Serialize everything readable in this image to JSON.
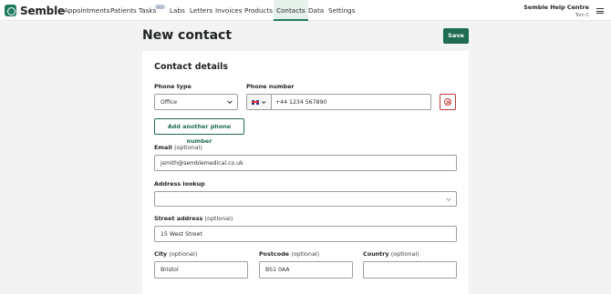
{
  "app": {
    "name": "Semble"
  },
  "nav": {
    "items": [
      {
        "label": "Appointments"
      },
      {
        "label": "Patients"
      },
      {
        "label": "Tasks",
        "badge": "NEW"
      },
      {
        "label": "Labs"
      },
      {
        "label": "Letters"
      },
      {
        "label": "Invoices"
      },
      {
        "label": "Products"
      },
      {
        "label": "Contacts",
        "active": true
      },
      {
        "label": "Data"
      },
      {
        "label": "Settings"
      }
    ],
    "help_title": "Semble Help Centre",
    "user": "Tom C"
  },
  "page": {
    "title": "New contact",
    "save_label": "Save"
  },
  "form": {
    "section_title": "Contact details",
    "phone_type_label": "Phone type",
    "phone_type_value": "Office",
    "phone_number_label": "Phone number",
    "phone_number_value": "+44 1234 567890",
    "add_phone_label": "Add another phone number",
    "email_label": "Email",
    "email_optional": "(optional)",
    "email_value": "jsmith@semblemedical.co.uk",
    "address_lookup_label": "Address lookup",
    "address_lookup_value": "",
    "street_label": "Street address",
    "street_optional": "(optional)",
    "street_value": "15 West Street",
    "city_label": "City",
    "city_optional": "(optional)",
    "city_value": "Bristol",
    "postcode_label": "Postcode",
    "postcode_optional": "(optional)",
    "postcode_value": "BS1 0AA",
    "country_label": "Country",
    "country_optional": "(optional)",
    "country_value": ""
  },
  "colors": {
    "brand": "#1f7a5e",
    "primary_button": "#1f6b54",
    "danger": "#c23a3a",
    "active_nav_bg": "#e7f1ec"
  }
}
